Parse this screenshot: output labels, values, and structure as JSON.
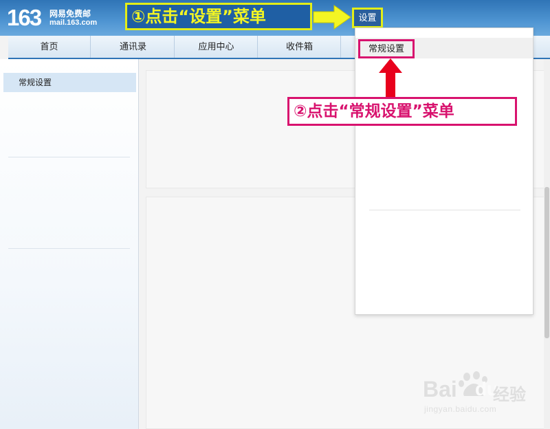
{
  "header": {
    "logo_number": "163",
    "logo_cn": "网易免费邮",
    "logo_domain": "mail.163.com",
    "settings_label": "设置"
  },
  "annotations": {
    "step1": "①点击“设置”菜单",
    "step2": "②点击“常规设置”菜单"
  },
  "nav": {
    "items": [
      {
        "label": "首页"
      },
      {
        "label": "通讯录"
      },
      {
        "label": "应用中心"
      },
      {
        "label": "收件箱"
      }
    ]
  },
  "sidebar": {
    "items": [
      {
        "label": "常规设置"
      }
    ]
  },
  "dropdown": {
    "items": [
      {
        "label": "常规设置"
      }
    ]
  },
  "watermark": {
    "brand": "Bai",
    "brand_tail": "du",
    "cn": "经验",
    "url": "jingyan.baidu.com"
  },
  "colors": {
    "header_blue": "#2f74b6",
    "callout_yellow": "#e4ee17",
    "callout_magenta": "#d8126e",
    "arrow_red": "#e8001c"
  }
}
